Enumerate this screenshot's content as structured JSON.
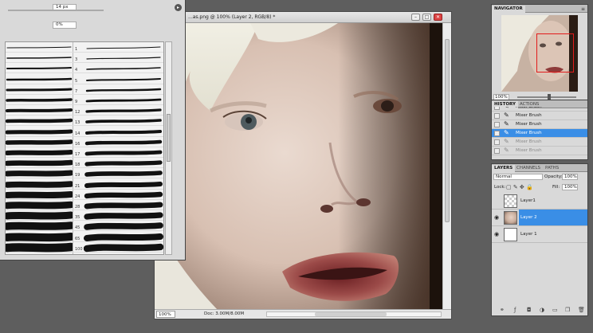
{
  "brushes_panel": {
    "size_value": "14 px",
    "spacing_value": "0%",
    "rows": [
      {
        "num": "1",
        "thickness": 1
      },
      {
        "num": "3",
        "thickness": 1.5
      },
      {
        "num": "4",
        "thickness": 2
      },
      {
        "num": "5",
        "thickness": 2.5
      },
      {
        "num": "7",
        "thickness": 3
      },
      {
        "num": "9",
        "thickness": 3.5
      },
      {
        "num": "12",
        "thickness": 4
      },
      {
        "num": "13",
        "thickness": 4.5
      },
      {
        "num": "14",
        "thickness": 5
      },
      {
        "num": "16",
        "thickness": 5.5
      },
      {
        "num": "17",
        "thickness": 6
      },
      {
        "num": "18",
        "thickness": 6.5
      },
      {
        "num": "19",
        "thickness": 7
      },
      {
        "num": "21",
        "thickness": 7.5
      },
      {
        "num": "24",
        "thickness": 8
      },
      {
        "num": "28",
        "thickness": 8.5
      },
      {
        "num": "35",
        "thickness": 9
      },
      {
        "num": "45",
        "thickness": 9.5
      },
      {
        "num": "65",
        "thickness": 10
      },
      {
        "num": "100",
        "thickness": 10.5
      }
    ]
  },
  "document": {
    "title": "...as.png @ 100% (Layer 2, RGB/8) *",
    "minimize": "–",
    "restore": "□",
    "close": "✕",
    "zoom": "100%",
    "doc_info": "Doc: 3.00M/8.00M"
  },
  "navigator": {
    "tab": "NAVIGATOR",
    "menu": "≡",
    "zoom": "100%"
  },
  "history": {
    "tabs": [
      "HISTORY",
      "ACTIONS"
    ],
    "items": [
      {
        "label": "Mixer Brush",
        "state": "normal"
      },
      {
        "label": "Mixer Brush",
        "state": "normal"
      },
      {
        "label": "Mixer Brush",
        "state": "normal"
      },
      {
        "label": "Mixer Brush",
        "state": "selected"
      },
      {
        "label": "Mixer Brush",
        "state": "dim"
      },
      {
        "label": "Mixer Brush",
        "state": "dim"
      }
    ]
  },
  "layers": {
    "tabs": [
      "LAYERS",
      "CHANNELS",
      "PATHS"
    ],
    "blend_mode": "Normal",
    "opacity_label": "Opacity:",
    "opacity_value": "100%",
    "lock_label": "Lock:",
    "fill_label": "Fill:",
    "fill_value": "100%",
    "items": [
      {
        "name": "Layer1",
        "visible": false,
        "selected": false,
        "thumb": "checker"
      },
      {
        "name": "Layer 2",
        "visible": true,
        "selected": true,
        "thumb": "face"
      },
      {
        "name": "Layer 1",
        "visible": true,
        "selected": false,
        "thumb": "white"
      }
    ]
  }
}
